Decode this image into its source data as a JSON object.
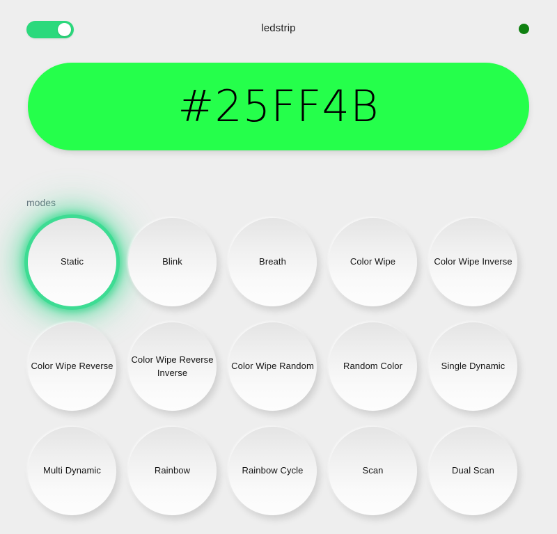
{
  "header": {
    "title": "ledstrip",
    "power_toggle": {
      "name": "power-toggle",
      "state": "on"
    },
    "status_indicator": {
      "name": "status-dot",
      "color": "#0f8010"
    }
  },
  "color_bar": {
    "value": "#25FF4B",
    "background_color": "#25FF4B",
    "text_color": "#000000"
  },
  "modes": {
    "section_label": "modes",
    "selected": "Static",
    "selection_glow_color": "#3ddc93",
    "rows": [
      [
        {
          "label": "Static",
          "selected": true,
          "wrap": false
        },
        {
          "label": "Blink",
          "selected": false,
          "wrap": false
        },
        {
          "label": "Breath",
          "selected": false,
          "wrap": false
        },
        {
          "label": "Color Wipe",
          "selected": false,
          "wrap": false
        },
        {
          "label": "Color Wipe Inverse",
          "selected": false,
          "wrap": true
        }
      ],
      [
        {
          "label": "Color Wipe Reverse",
          "selected": false,
          "wrap": true
        },
        {
          "label": "Color Wipe Reverse Inverse",
          "selected": false,
          "wrap": true
        },
        {
          "label": "Color Wipe Random",
          "selected": false,
          "wrap": true
        },
        {
          "label": "Random Color",
          "selected": false,
          "wrap": false
        },
        {
          "label": "Single Dynamic",
          "selected": false,
          "wrap": false
        }
      ],
      [
        {
          "label": "Multi Dynamic",
          "selected": false,
          "wrap": false
        },
        {
          "label": "Rainbow",
          "selected": false,
          "wrap": false
        },
        {
          "label": "Rainbow Cycle",
          "selected": false,
          "wrap": false
        },
        {
          "label": "Scan",
          "selected": false,
          "wrap": false
        },
        {
          "label": "Dual Scan",
          "selected": false,
          "wrap": false
        }
      ]
    ]
  },
  "theme": {
    "background": "#eeeeee",
    "accent_green": "#2bd97c",
    "glow_green": "#3ddc93",
    "label_gray": "#6b7480"
  }
}
